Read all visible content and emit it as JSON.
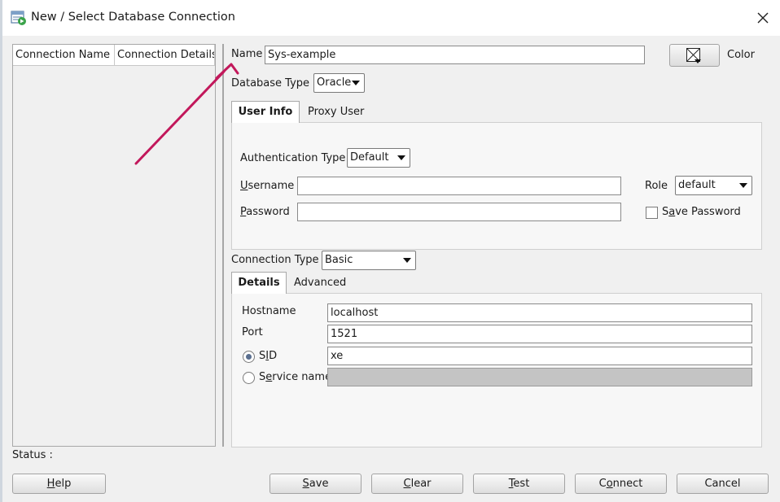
{
  "window": {
    "title": "New / Select Database Connection"
  },
  "connection_list": {
    "columns": [
      "Connection Name",
      "Connection Details"
    ]
  },
  "name": {
    "label": "Name",
    "value": "Sys-example"
  },
  "color": {
    "label": "Color"
  },
  "database_type": {
    "label": "Database Type",
    "selected": "Oracle"
  },
  "user_tabs": {
    "user_info": "User Info",
    "proxy_user": "Proxy User"
  },
  "auth_type": {
    "label": "Authentication Type",
    "selected": "Default"
  },
  "username": {
    "label_pre": "",
    "label_mnemonic": "U",
    "label_post": "sername",
    "value": ""
  },
  "password": {
    "label_pre": "",
    "label_mnemonic": "P",
    "label_post": "assword",
    "value": ""
  },
  "role": {
    "label": "Role",
    "selected": "default"
  },
  "save_password": {
    "label_pre": "S",
    "label_mnemonic": "a",
    "label_post": "ve Password",
    "checked": false
  },
  "connection_type": {
    "label": "Connection Type",
    "selected": "Basic"
  },
  "detail_tabs": {
    "details": "Details",
    "advanced": "Advanced"
  },
  "hostname": {
    "label": "Hostname",
    "value": "localhost"
  },
  "port": {
    "label": "Port",
    "value": "1521"
  },
  "sid": {
    "label_pre": "S",
    "label_mnemonic": "I",
    "label_post": "D",
    "value": "xe",
    "selected": true
  },
  "service_name": {
    "label_pre": "S",
    "label_mnemonic": "e",
    "label_post": "rvice name",
    "value": ""
  },
  "status": {
    "label": "Status :"
  },
  "buttons": {
    "help_mn": "H",
    "help_rest": "elp",
    "save_mn": "S",
    "save_rest": "ave",
    "clear_mn": "C",
    "clear_rest": "lear",
    "test_mn": "T",
    "test_rest": "est",
    "connect_pre": "C",
    "connect_mn": "o",
    "connect_rest": "nnect",
    "cancel": "Cancel"
  },
  "annotation": {
    "arrow_color": "#c2185b"
  }
}
